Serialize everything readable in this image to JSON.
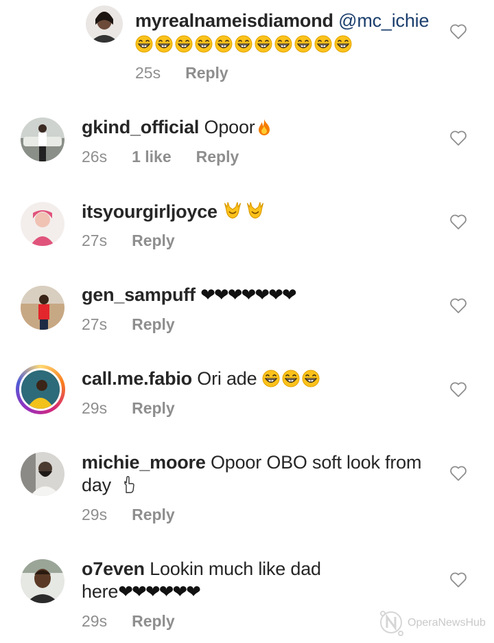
{
  "reply_label": "Reply",
  "comments": [
    {
      "username": "myrealnameisdiamond",
      "mention": "@mc_ichie",
      "text": "",
      "emoji": "grin",
      "emoji_count": 11,
      "time": "25s",
      "likes": ""
    },
    {
      "username": "gkind_official",
      "text": "Opoor",
      "emoji": "fire",
      "emoji_count": 1,
      "time": "26s",
      "likes": "1 like"
    },
    {
      "username": "itsyourgirljoyce",
      "text": "",
      "emoji": "hands-raised",
      "emoji_count": 2,
      "time": "27s",
      "likes": ""
    },
    {
      "username": "gen_sampuff",
      "text": "",
      "hearts": "❤❤❤❤❤❤❤",
      "time": "27s",
      "likes": ""
    },
    {
      "username": "call.me.fabio",
      "text": "Ori ade",
      "emoji": "grin",
      "emoji_count": 3,
      "time": "29s",
      "likes": ""
    },
    {
      "username": "michie_moore",
      "text_line1": "Opoor OBO soft look from",
      "text_line2": "day",
      "emoji": "pointing-hand",
      "time": "29s",
      "likes": ""
    },
    {
      "username": "o7even",
      "text_line1": "Lookin much like dad",
      "text_line2": "here",
      "hearts": "❤❤❤❤❤❤",
      "time": "29s",
      "likes": ""
    }
  ],
  "watermark": "OperaNewsHub",
  "colors": {
    "meta": "#8e8e8e",
    "mention": "#1c3f6e",
    "heart_outline": "#8e8e8e"
  }
}
